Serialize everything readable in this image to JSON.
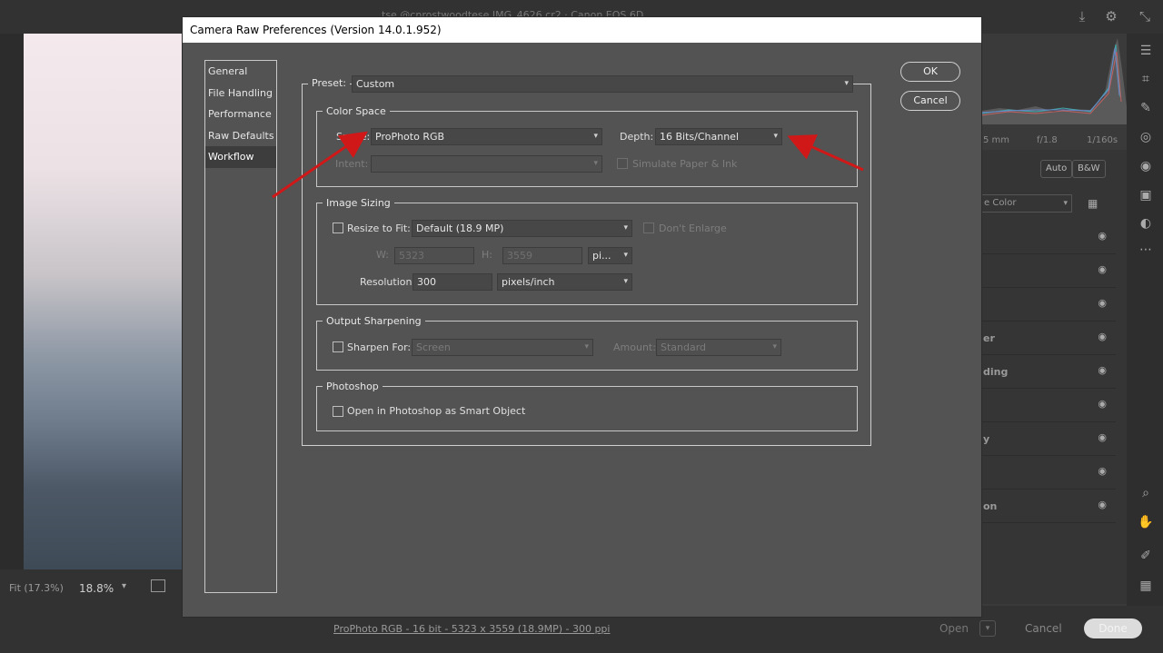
{
  "background": {
    "file_title": "tse @cnrostwoodtese IMG_4626.cr2 · Canon EOS 6D",
    "zoom_fit": "Fit (17.3%)",
    "zoom_value": "18.8%",
    "exif": {
      "focal": "5 mm",
      "aperture": "f/1.8",
      "shutter": "1/160s"
    },
    "auto_label": "Auto",
    "bw_label": "B&W",
    "profile_value": "e Color",
    "panel_rows": [
      "",
      "",
      "",
      "er",
      "ding",
      "",
      "y",
      "",
      "on"
    ],
    "status_link": "ProPhoto RGB - 16 bit - 5323 x 3559 (18.9MP) - 300 ppi",
    "open_label": "Open",
    "cancel_label": "Cancel",
    "done_label": "Done"
  },
  "dialog": {
    "title": "Camera Raw Preferences  (Version 14.0.1.952)",
    "categories": [
      {
        "label": "General",
        "selected": false
      },
      {
        "label": "File Handling",
        "selected": false
      },
      {
        "label": "Performance",
        "selected": false
      },
      {
        "label": "Raw Defaults",
        "selected": false
      },
      {
        "label": "Workflow",
        "selected": true
      }
    ],
    "ok_label": "OK",
    "cancel_label": "Cancel",
    "preset_label": "Preset:",
    "preset_value": "Custom",
    "color_space": {
      "title": "Color Space",
      "space_label": "Space:",
      "space_value": "ProPhoto RGB",
      "depth_label": "Depth:",
      "depth_value": "16 Bits/Channel",
      "intent_label": "Intent:",
      "intent_value": "",
      "simulate_label": "Simulate Paper & Ink"
    },
    "image_sizing": {
      "title": "Image Sizing",
      "resize_label": "Resize to Fit:",
      "resize_value": "Default  (18.9 MP)",
      "dont_enlarge_label": "Don't Enlarge",
      "w_label": "W:",
      "w_value": "5323",
      "h_label": "H:",
      "h_value": "3559",
      "unit_value": "pi...",
      "resolution_label": "Resolution:",
      "resolution_value": "300",
      "resolution_unit": "pixels/inch"
    },
    "output_sharpening": {
      "title": "Output Sharpening",
      "sharpen_label": "Sharpen For:",
      "sharpen_value": "Screen",
      "amount_label": "Amount:",
      "amount_value": "Standard"
    },
    "photoshop": {
      "title": "Photoshop",
      "smart_object_label": "Open in Photoshop as Smart Object"
    }
  },
  "colors": {
    "annotation_arrow": "#d01818",
    "dialog_bg": "#535353",
    "title_bar": "#ffffff"
  }
}
